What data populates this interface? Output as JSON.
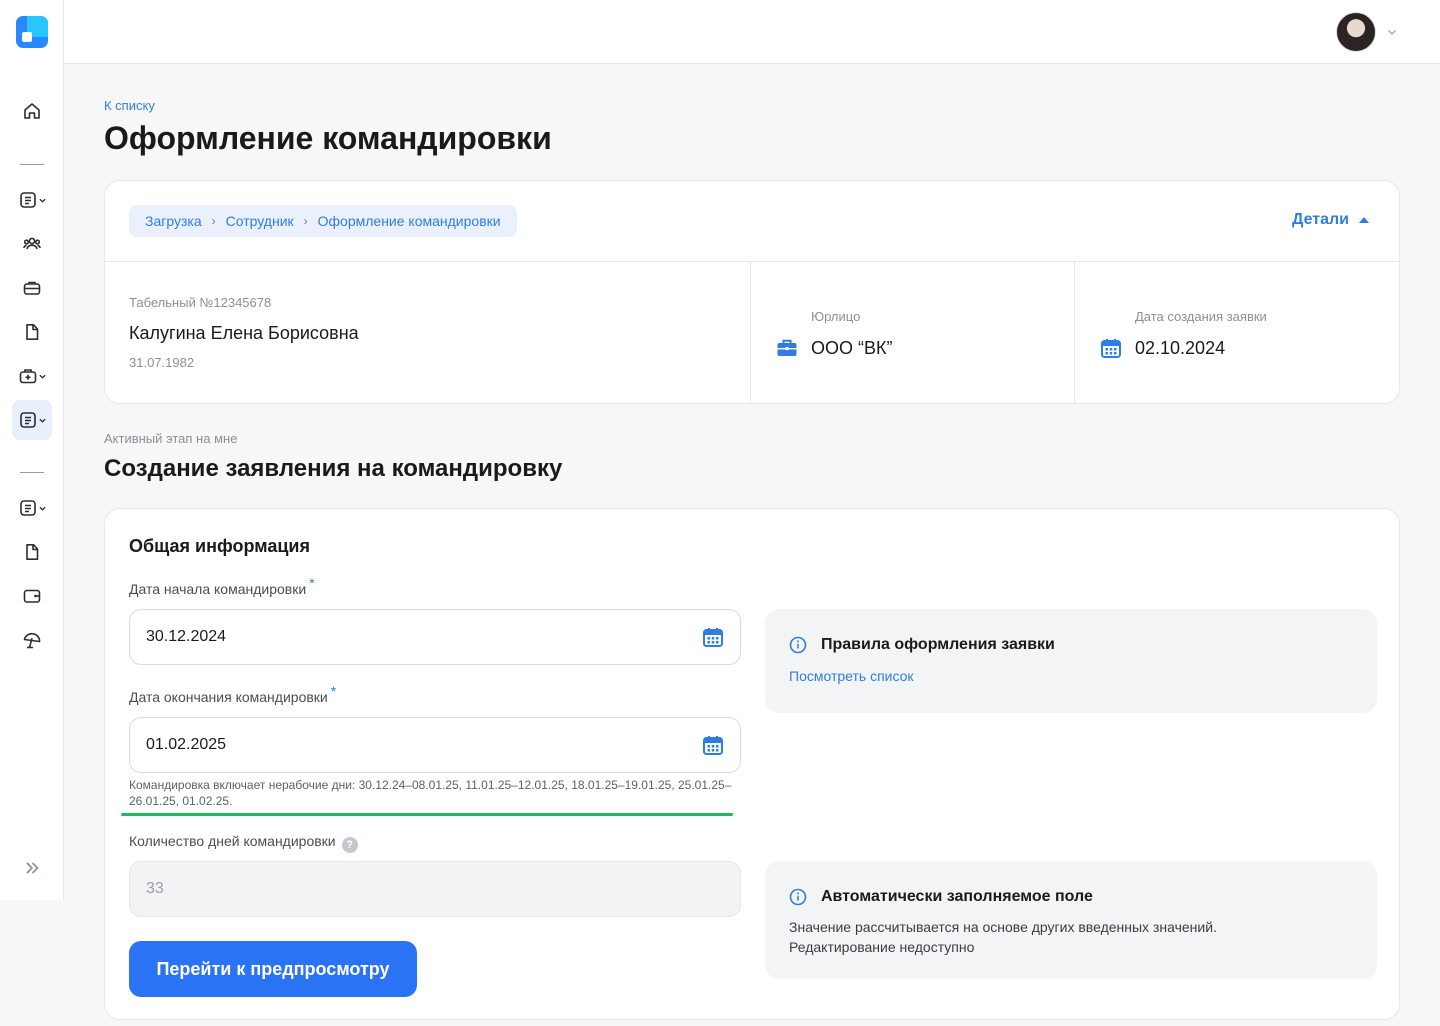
{
  "colors": {
    "accent": "#2a73f5",
    "link": "#2f7de1",
    "success": "#1fba5e"
  },
  "icons": {
    "sidebar": [
      "home-icon",
      "document-list-icon",
      "users-icon",
      "briefcase-icon",
      "file-icon",
      "medical-bag-icon",
      "document-list-icon",
      "document-list-icon",
      "file-icon",
      "wallet-icon",
      "beach-umbrella-icon",
      "double-chevron-right-icon"
    ]
  },
  "nav": {
    "back": "К списку"
  },
  "page": {
    "title": "Оформление командировки"
  },
  "breadcrumb": {
    "items": [
      "Загрузка",
      "Сотрудник",
      "Оформление командировки"
    ]
  },
  "details": {
    "label": "Детали"
  },
  "employee": {
    "tab_number": "Табельный №12345678",
    "name": "Калугина Елена Борисовна",
    "dob": "31.07.1982"
  },
  "legal_entity": {
    "label": "Юрлицо",
    "value": "ООО “ВК”"
  },
  "created": {
    "label": "Дата создания заявки",
    "value": "02.10.2024"
  },
  "stage": {
    "label": "Активный этап на мне",
    "title": "Создание заявления на командировку"
  },
  "form": {
    "title": "Общая информация",
    "start_label": "Дата начала командировки",
    "start_value": "30.12.2024",
    "end_label": "Дата окончания командировки",
    "end_value": "01.02.2025",
    "required_mark": "*",
    "hint": "Командировка включает нерабочие дни: 30.12.24–08.01.25, 11.01.25–12.01.25, 18.01.25–19.01.25, 25.01.25–26.01.25, 01.02.25.",
    "days_label": "Количество дней командировки",
    "days_help": "?",
    "days_value": "33",
    "submit": "Перейти к предпросмотру"
  },
  "rules_note": {
    "title": "Правила оформления заявки",
    "link": "Посмотреть список"
  },
  "auto_note": {
    "title": "Автоматически заполняемое поле",
    "line1": "Значение рассчитывается на основе других введенных значений.",
    "line2": "Редактирование недоступно"
  }
}
